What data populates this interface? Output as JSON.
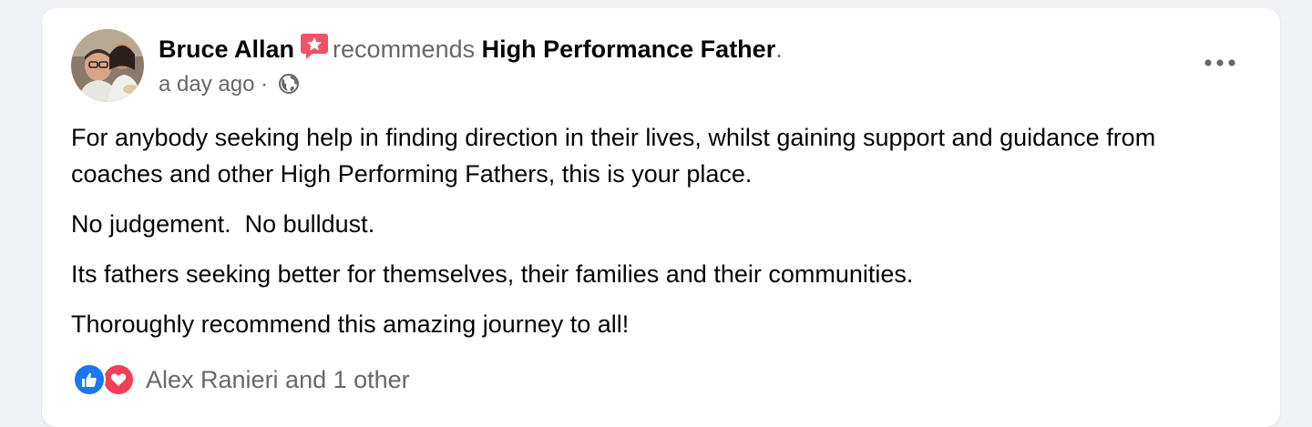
{
  "post": {
    "author": "Bruce Allan",
    "verb": "recommends",
    "page": "High Performance Father",
    "period": ".",
    "time": "a day ago",
    "separator": "·",
    "privacy_icon": "globe-icon",
    "more_icon": "more-horizontal-icon",
    "recommend_badge_icon": "recommend-star-icon",
    "paragraphs": [
      "For anybody seeking help in finding direction in their lives, whilst gaining support and guidance from coaches and other High Performing Fathers, this is your place.",
      "No judgement.  No bulldust.",
      "Its fathers seeking better for themselves, their families and their communities.",
      "Thoroughly recommend this amazing journey to all!"
    ]
  },
  "reactions": {
    "icons": [
      "like-icon",
      "love-icon"
    ],
    "summary": "Alex Ranieri and 1 other"
  },
  "colors": {
    "like": "#1877f2",
    "love": "#f33e58",
    "recommend_badge": "#f25268",
    "secondary_text": "#65676b",
    "primary_text": "#050505"
  }
}
